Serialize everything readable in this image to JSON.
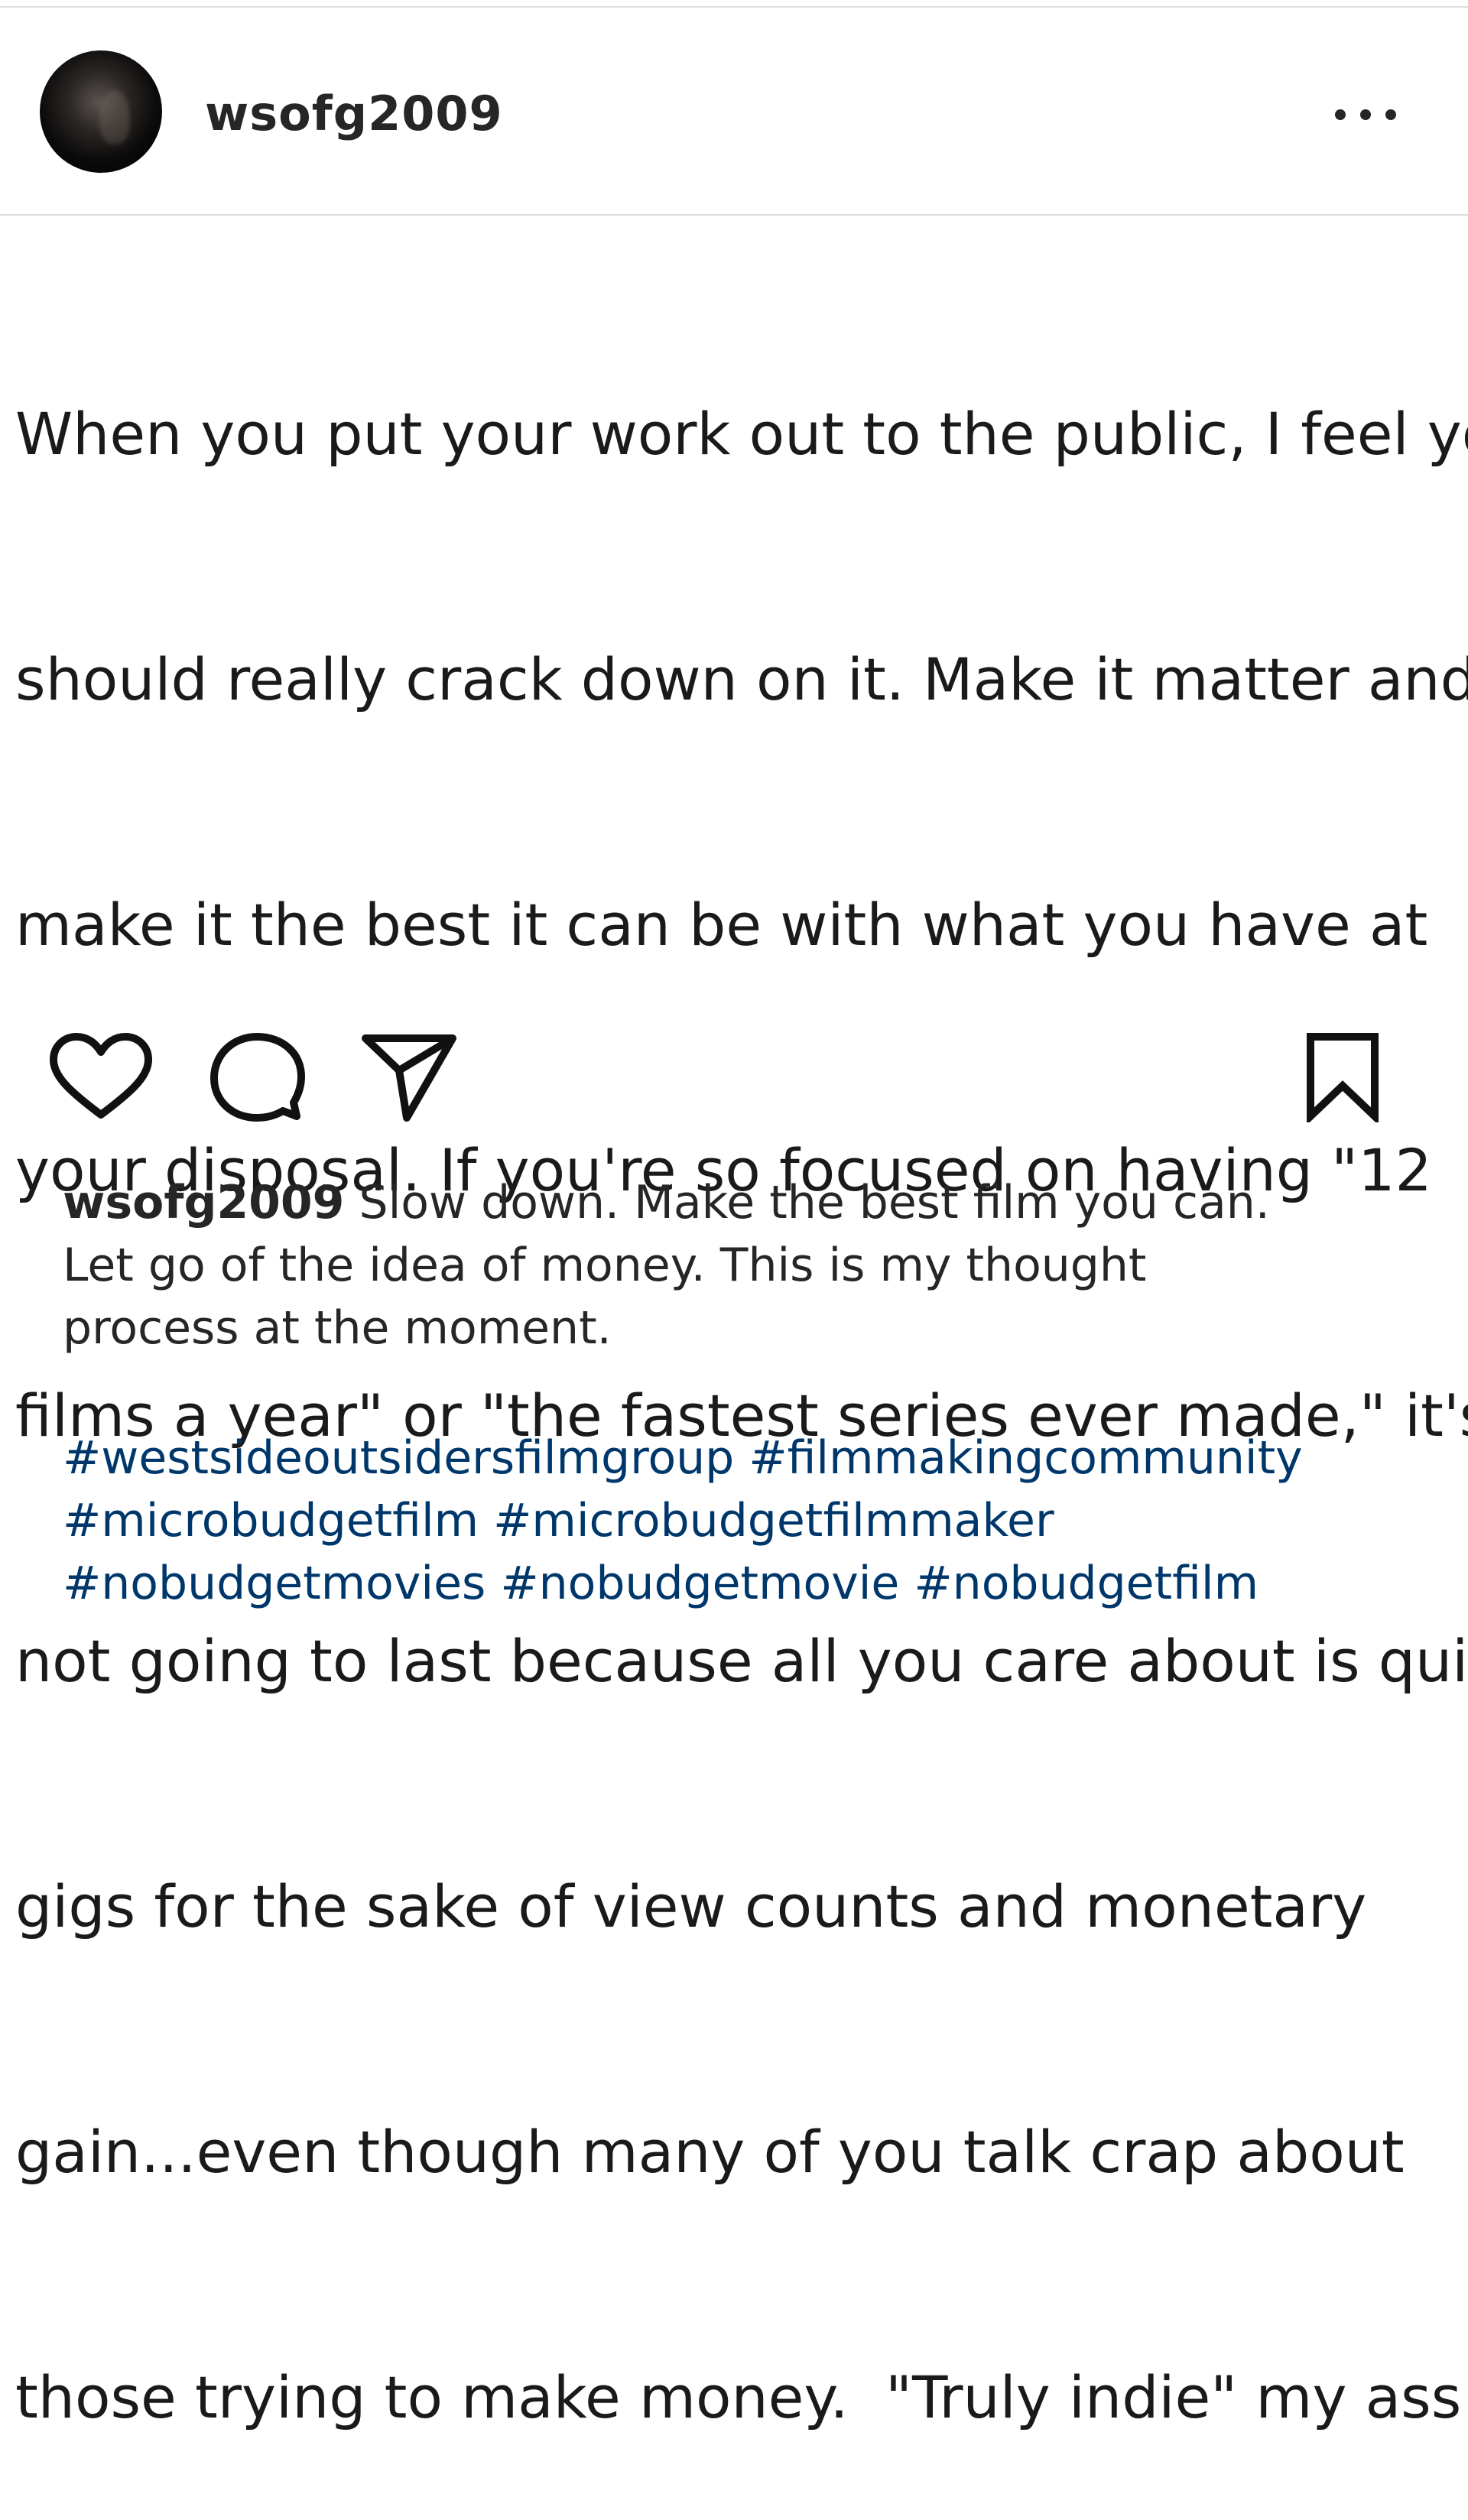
{
  "post": {
    "username": "wsofg2009",
    "more_icon": "more-horizontal-icon",
    "text_lines": [
      "When you put your work out to the public, I feel you",
      "should really crack down on it. Make it matter and",
      "make it the best it can be with what you have at",
      "your disposal. If you're so focused on having \"12",
      "films a year\" or \"the fastest series ever made,\" it's",
      "not going to last because all you care about is quic",
      "gigs for the sake of view counts and monetary",
      "gain...even though many of you talk crap about",
      "those trying to make money.  \"Truly indie\" my ass!"
    ]
  },
  "actions": {
    "like_icon": "heart-icon",
    "comment_icon": "comment-icon",
    "share_icon": "paper-plane-icon",
    "save_icon": "bookmark-icon"
  },
  "caption": {
    "username": "wsofg2009",
    "line_1_rest": " Slow down. Make the best film you can.",
    "line_2": "Let go of the idea of money. This is my thought",
    "line_3": "process at the moment."
  },
  "hashtags": {
    "line_1": [
      "#westsideoutsidersfilmgroup",
      "#filmmakingcommunity"
    ],
    "line_2": [
      "#microbudgetfilm",
      "#microbudgetfilmmaker"
    ],
    "line_3": [
      "#nobudgetmovies",
      "#nobudgetmovie",
      "#nobudgetfilm"
    ]
  },
  "colors": {
    "hashtag": "#00376b",
    "text": "#1a1a1a",
    "divider": "#dcdcdc"
  }
}
